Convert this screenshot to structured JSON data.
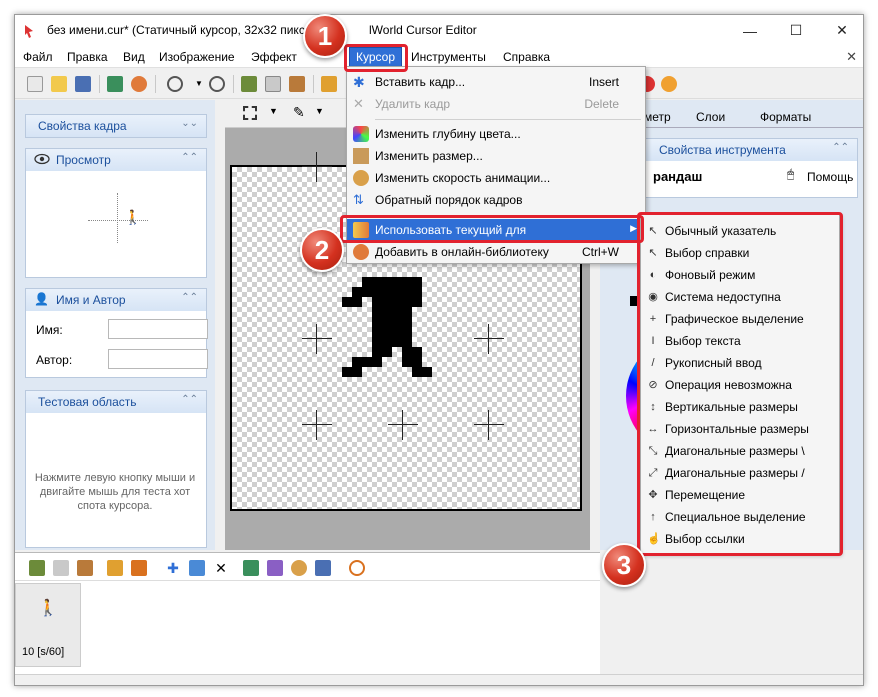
{
  "window": {
    "title": "без имени.cur* (Статичный курсор, 32x32 пиксе",
    "title_suffix": "lWorld Cursor Editor",
    "minimize": "—",
    "maximize": "☐",
    "close": "✕"
  },
  "menubar": {
    "items": [
      "Файл",
      "Правка",
      "Вид",
      "Изображение",
      "Эффект",
      "Курсор",
      "Инструменты",
      "Справка"
    ]
  },
  "left_panels": {
    "frame_props": "Свойства кадра",
    "preview": "Просмотр",
    "name_author": "Имя и Автор",
    "name_label": "Имя:",
    "author_label": "Автор:",
    "test_area": "Тестовая область",
    "test_hint": "Нажмите левую кнопку мыши и двигайте мышь для теста хот спота курсора."
  },
  "right_panels": {
    "tabs": [
      "метр",
      "Слои",
      "Форматы"
    ],
    "tool_props": "Свойства инструмента",
    "tool_name": "рандаш",
    "help": "Помощь"
  },
  "cursor_menu": {
    "items": [
      {
        "label": "Вставить кадр...",
        "shortcut": "Insert",
        "disabled": false
      },
      {
        "label": "Удалить кадр",
        "shortcut": "Delete",
        "disabled": true
      },
      {
        "label": "Изменить глубину цвета...",
        "shortcut": "",
        "disabled": false
      },
      {
        "label": "Изменить размер...",
        "shortcut": "",
        "disabled": false
      },
      {
        "label": "Изменить скорость анимации...",
        "shortcut": "",
        "disabled": false
      },
      {
        "label": "Обратный порядок кадров",
        "shortcut": "",
        "disabled": false
      },
      {
        "label": "Использовать текущий для",
        "shortcut": "",
        "disabled": false
      },
      {
        "label": "Добавить в онлайн-библиотеку",
        "shortcut": "Ctrl+W",
        "disabled": false
      }
    ]
  },
  "submenu": {
    "items": [
      "Обычный указатель",
      "Выбор справки",
      "Фоновый режим",
      "Система недоступна",
      "Графическое выделение",
      "Выбор текста",
      "Рукописный ввод",
      "Операция невозможна",
      "Вертикальные размеры",
      "Горизонтальные размеры",
      "Диагональные размеры \\",
      "Диагональные размеры /",
      "Перемещение",
      "Специальное выделение",
      "Выбор ссылки"
    ]
  },
  "frames": {
    "frame_label": "10 [s/60]"
  },
  "badges": [
    "1",
    "2",
    "3"
  ],
  "colors": {
    "accent": "#2f6fd6",
    "highlight_red": "#e2222e",
    "badge_red": "#d4311f"
  }
}
